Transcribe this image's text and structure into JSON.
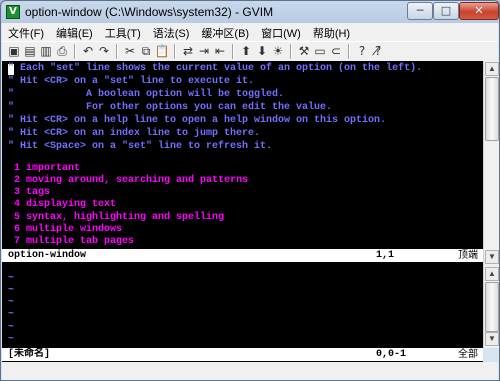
{
  "window": {
    "title": "option-window (C:\\Windows\\system32) - GVIM",
    "icon_label": "V",
    "minimize_glyph": "─",
    "maximize_glyph": "□",
    "close_glyph": "✕"
  },
  "menu": {
    "items": [
      "文件(F)",
      "编辑(E)",
      "工具(T)",
      "语法(S)",
      "缓冲区(B)",
      "窗口(W)",
      "帮助(H)"
    ]
  },
  "toolbar": {
    "icons": [
      {
        "name": "open-icon",
        "glyph": "▣"
      },
      {
        "name": "save-icon",
        "glyph": "▤"
      },
      {
        "name": "save-all-icon",
        "glyph": "▥"
      },
      {
        "name": "print-icon",
        "glyph": "⎙"
      },
      {
        "name": "undo-icon",
        "glyph": "↶"
      },
      {
        "name": "redo-icon",
        "glyph": "↷"
      },
      {
        "name": "cut-icon",
        "glyph": "✂"
      },
      {
        "name": "copy-icon",
        "glyph": "⧉"
      },
      {
        "name": "paste-icon",
        "glyph": "📋"
      },
      {
        "name": "replace-icon",
        "glyph": "⇄"
      },
      {
        "name": "find-next-icon",
        "glyph": "⇥"
      },
      {
        "name": "find-prev-icon",
        "glyph": "⇤"
      },
      {
        "name": "load-session-icon",
        "glyph": "⬆"
      },
      {
        "name": "save-session-icon",
        "glyph": "⬇"
      },
      {
        "name": "run-script-icon",
        "glyph": "☀"
      },
      {
        "name": "make-icon",
        "glyph": "⚒"
      },
      {
        "name": "shell-icon",
        "glyph": "▭"
      },
      {
        "name": "ctags-icon",
        "glyph": "⊂"
      },
      {
        "name": "help-icon",
        "glyph": "?"
      },
      {
        "name": "find-help-icon",
        "glyph": "?̸"
      }
    ]
  },
  "editor": {
    "header_lines": [
      "\" Each \"set\" line shows the current value of an option (on the left).",
      "\" Hit <CR> on a \"set\" line to execute it.",
      "\"            A boolean option will be toggled.",
      "\"            For other options you can edit the value.",
      "\" Hit <CR> on a help line to open a help window on this option.",
      "\" Hit <CR> on an index line to jump there.",
      "\" Hit <Space> on a \"set\" line to refresh it."
    ],
    "index_lines": [
      {
        "num": " 1",
        "text": "important"
      },
      {
        "num": " 2",
        "text": "moving around, searching and patterns"
      },
      {
        "num": " 3",
        "text": "tags"
      },
      {
        "num": " 4",
        "text": "displaying text"
      },
      {
        "num": " 5",
        "text": "syntax, highlighting and spelling"
      },
      {
        "num": " 6",
        "text": "multiple windows"
      },
      {
        "num": " 7",
        "text": "multiple tab pages"
      }
    ],
    "top_status": {
      "name": "option-window",
      "position": "1,1",
      "percent": "顶端"
    },
    "empty_lines": [
      "~",
      "~",
      "~",
      "~",
      "~",
      "~"
    ],
    "bottom_status": {
      "name": "[未命名]",
      "position": "0,0-1",
      "percent": "全部"
    }
  },
  "colors": {
    "comment": "#7070ff",
    "index": "#ff00ff",
    "background": "#000000"
  }
}
